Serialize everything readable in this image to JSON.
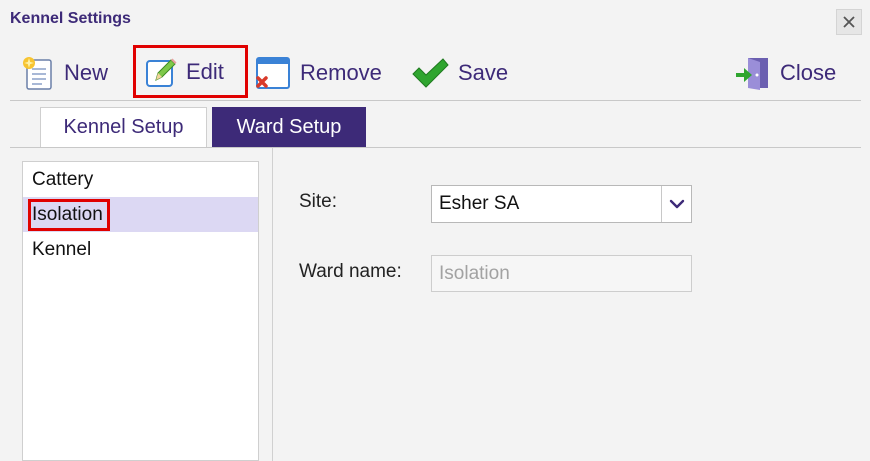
{
  "window": {
    "title": "Kennel Settings"
  },
  "toolbar": {
    "new_label": "New",
    "edit_label": "Edit",
    "remove_label": "Remove",
    "save_label": "Save",
    "close_label": "Close"
  },
  "tabs": [
    {
      "label": "Kennel Setup",
      "active": false
    },
    {
      "label": "Ward Setup",
      "active": true
    }
  ],
  "ward_list": {
    "items": [
      "Cattery",
      "Isolation",
      "Kennel"
    ],
    "selected": "Isolation"
  },
  "form": {
    "site_label": "Site:",
    "site_value": "Esher SA",
    "ward_name_label": "Ward name:",
    "ward_name_placeholder": "Isolation"
  },
  "icons": {
    "new": "new-document-icon",
    "edit": "pencil-edit-icon",
    "remove": "remove-window-icon",
    "save": "green-check-icon",
    "close": "exit-door-icon",
    "dropdown": "chevron-down-icon",
    "window_close": "close-icon"
  },
  "colors": {
    "brand": "#3d2a78",
    "selected_row": "#dcd8f3",
    "highlight": "#e00000",
    "save_green": "#2fa52f"
  }
}
